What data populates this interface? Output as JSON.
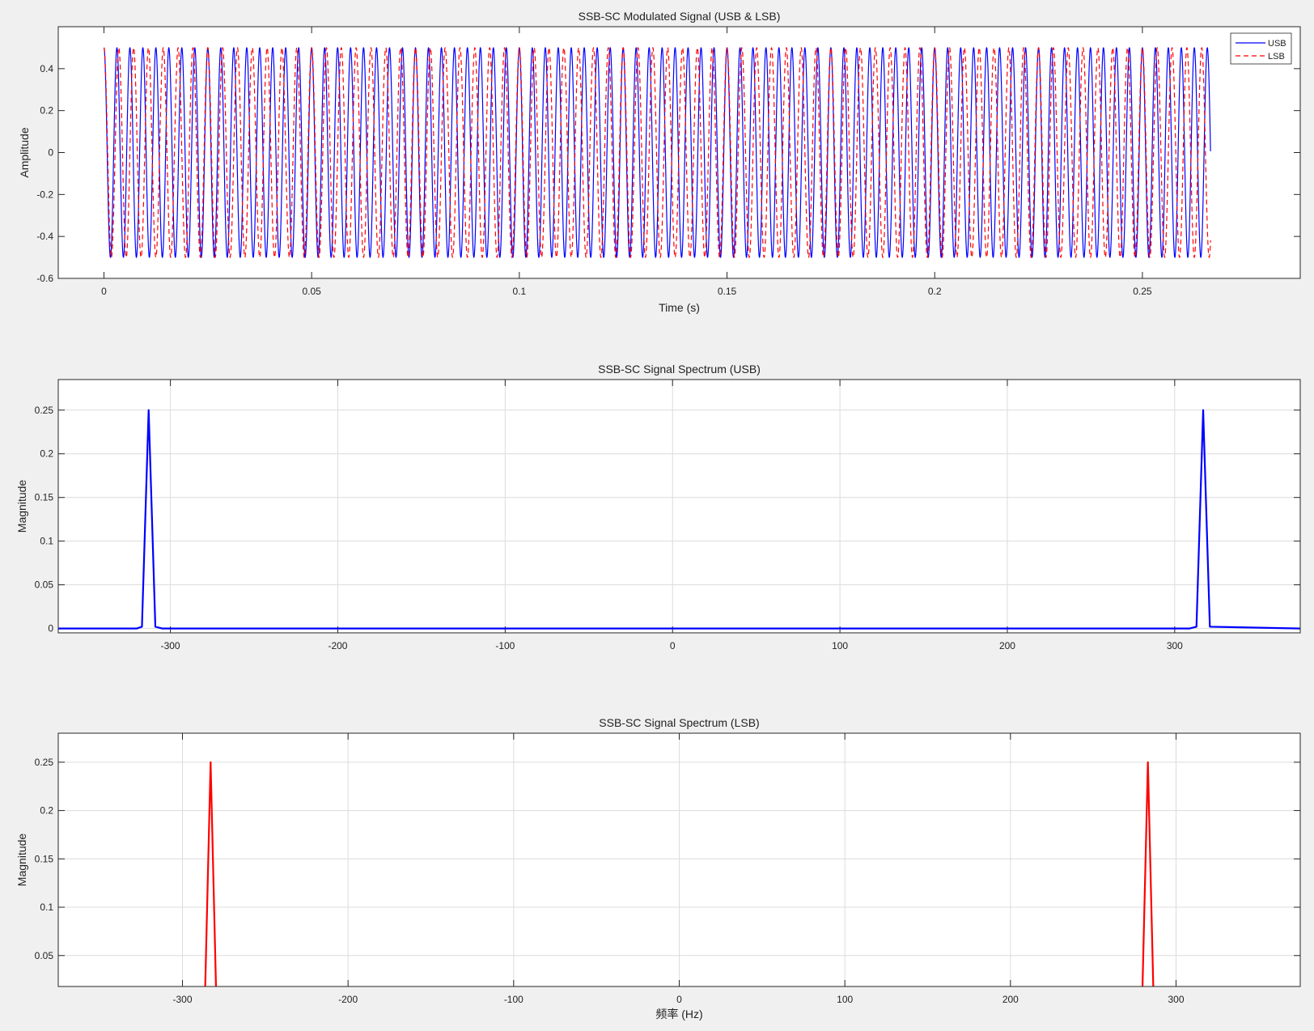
{
  "figure": {
    "background": "#f0f0f0"
  },
  "chart_data": [
    {
      "type": "line",
      "title": "SSB-SC Modulated Signal (USB & LSB)",
      "xlabel": "Time (s)",
      "ylabel": "Amplitude",
      "xlim": [
        -0.011,
        0.288
      ],
      "ylim": [
        -0.6,
        0.6
      ],
      "xticks": [
        0,
        0.05,
        0.1,
        0.15,
        0.2,
        0.25
      ],
      "xtick_labels": [
        "0",
        "0.05",
        "0.1",
        "0.15",
        "0.2",
        "0.25"
      ],
      "yticks": [
        -0.6,
        -0.4,
        -0.2,
        0,
        0.2,
        0.4
      ],
      "ytick_labels": [
        "-0.6",
        "-0.4",
        "-0.2",
        "0",
        "0.2",
        "0.4"
      ],
      "grid": false,
      "legend": {
        "position": "top-right",
        "entries": [
          "USB",
          "LSB"
        ]
      },
      "series": [
        {
          "name": "USB",
          "color": "#0000ff",
          "style": "solid",
          "function": "0.5*cos(2*pi*f*t)",
          "frequency_hz": 320,
          "t_start": 0,
          "t_end": 0.2664,
          "amplitude": 0.5
        },
        {
          "name": "LSB",
          "color": "#ff0000",
          "style": "dashed",
          "function": "0.5*cos(2*pi*f*t)",
          "frequency_hz": 280,
          "t_start": 0,
          "t_end": 0.2664,
          "amplitude": 0.5
        }
      ]
    },
    {
      "type": "line",
      "title": "SSB-SC Signal Spectrum (USB)",
      "xlabel": "",
      "ylabel": "Magnitude",
      "xlim": [
        -367,
        375
      ],
      "ylim": [
        -0.005,
        0.285
      ],
      "xticks": [
        -300,
        -200,
        -100,
        0,
        100,
        200,
        300
      ],
      "xtick_labels": [
        "-300",
        "-200",
        "-100",
        "0",
        "100",
        "200",
        "300"
      ],
      "yticks": [
        0,
        0.05,
        0.1,
        0.15,
        0.2,
        0.25
      ],
      "ytick_labels": [
        "0",
        "0.05",
        "0.1",
        "0.15",
        "0.2",
        "0.25"
      ],
      "grid": true,
      "series": [
        {
          "color": "#0000ff",
          "x": [
            -367,
            -320,
            -317,
            -313,
            -309,
            -305,
            305,
            309,
            313,
            317,
            321,
            375
          ],
          "y": [
            0,
            0,
            0.002,
            0.25,
            0.002,
            0,
            0,
            0,
            0.002,
            0.25,
            0.002,
            0
          ]
        }
      ]
    },
    {
      "type": "line",
      "title": "SSB-SC Signal Spectrum (LSB)",
      "xlabel": "频率 (Hz)",
      "ylabel": "Magnitude",
      "xlim": [
        -375,
        375
      ],
      "ylim": [
        0.018,
        0.28
      ],
      "xticks": [
        -300,
        -200,
        -100,
        0,
        100,
        200,
        300
      ],
      "xtick_labels": [
        "-300",
        "-200",
        "-100",
        "0",
        "100",
        "200",
        "300"
      ],
      "yticks": [
        0.05,
        0.1,
        0.15,
        0.2,
        0.25
      ],
      "ytick_labels": [
        "0.05",
        "0.1",
        "0.15",
        "0.2",
        "0.25"
      ],
      "grid": true,
      "series": [
        {
          "color": "#ff0000",
          "x": [
            -288,
            -286.5,
            -283,
            -279.5,
            -278,
            278,
            279.5,
            283,
            286.5,
            288
          ],
          "y": [
            0,
            0,
            0.25,
            0,
            0,
            0,
            0,
            0.25,
            0,
            0
          ]
        }
      ]
    }
  ]
}
